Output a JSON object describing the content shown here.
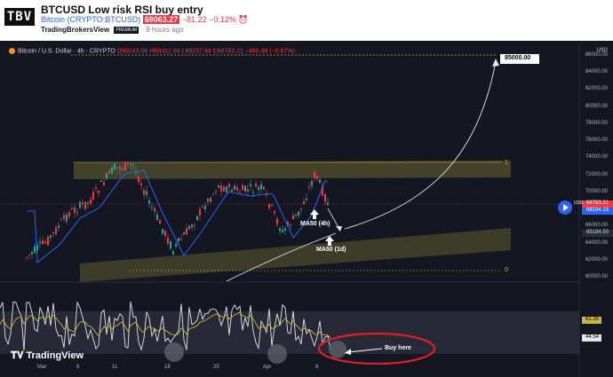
{
  "header": {
    "logo_text": "TBV",
    "title": "BTCUSD Low risk RSI buy entry",
    "symbol_name": "Bitcoin",
    "symbol_code": "(CRYPTO:BTCUSD)",
    "price": "69063.27",
    "change": "−81.22",
    "change_pct": "−0.12%",
    "author": "TradingBrokersView",
    "author_badge": "PREMIUM",
    "time_ago": "9 hours ago"
  },
  "legend": {
    "name": "Bitcoin / U.S. Dollar · 4h · CRYPTO",
    "ohlc": "O69243.06 H69312.84 L68237.94 C68783.21 −460.48 (−0.67%)"
  },
  "price_axis": {
    "currency": "USD",
    "ticks": [
      "86000.00",
      "84000.00",
      "82000.00",
      "80000.00",
      "78000.00",
      "76000.00",
      "74000.00",
      "72000.00",
      "70000.00",
      "66000.00",
      "64000.00",
      "62000.00",
      "60000.00"
    ]
  },
  "price_labels": {
    "last": "68783.21",
    "usd_badge": "USD",
    "ma_price": "68194.15",
    "ma_long": "65184.50",
    "rsi": "61.35",
    "rsi_ma": "44.54"
  },
  "annotations": {
    "target": "85000.00",
    "ma50_4h": "MA50 (4h)",
    "ma50_1d": "MA50 (1d)",
    "fib_1": "1",
    "fib_0": "0",
    "buy_here": "Buy here"
  },
  "x_axis": [
    "Mar",
    "6",
    "11",
    "18",
    "25",
    "Apr",
    "8"
  ],
  "footer": {
    "brand": "TradingView"
  },
  "colors": {
    "bg": "#141722",
    "up": "#26a69a",
    "down": "#f23645",
    "zone": "#4a4a2c",
    "ma": "#2962ff",
    "rsi": "#e6e6e6",
    "rsi_ma": "#c9b44c",
    "highlight": "#e31e24"
  }
}
